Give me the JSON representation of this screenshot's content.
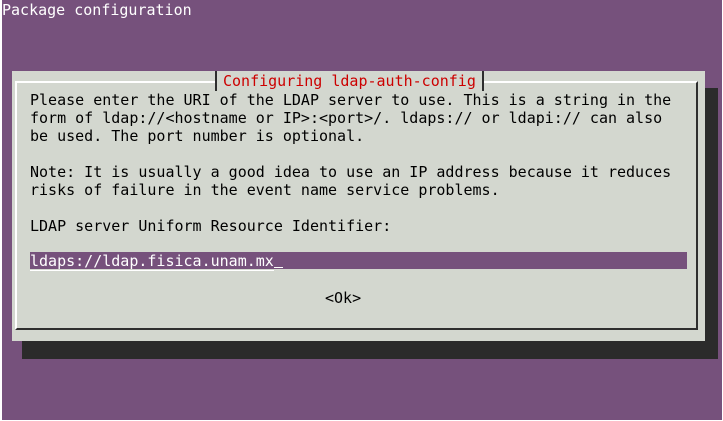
{
  "backtitle": "Package configuration",
  "dialog": {
    "title": "Configuring ldap-auth-config",
    "paragraph1_line1": "Please enter the URI of the LDAP server to use. This is a string in the",
    "paragraph1_line2": "form of ldap://<hostname or IP>:<port>/. ldaps:// or ldapi:// can also",
    "paragraph1_line3": "be used. The port number is optional.",
    "paragraph2_line1": "Note: It is usually a good idea to use an IP address because it reduces",
    "paragraph2_line2": "risks of failure in the event name service problems.",
    "prompt": "LDAP server Uniform Resource Identifier:",
    "input_value": "ldaps://ldap.fisica.unam.mx",
    "ok_label": "<Ok>"
  },
  "colors": {
    "background": "#76517c",
    "dialog": "#d3d7cf",
    "title": "#cc0000",
    "shadow": "#2b2b2b"
  }
}
